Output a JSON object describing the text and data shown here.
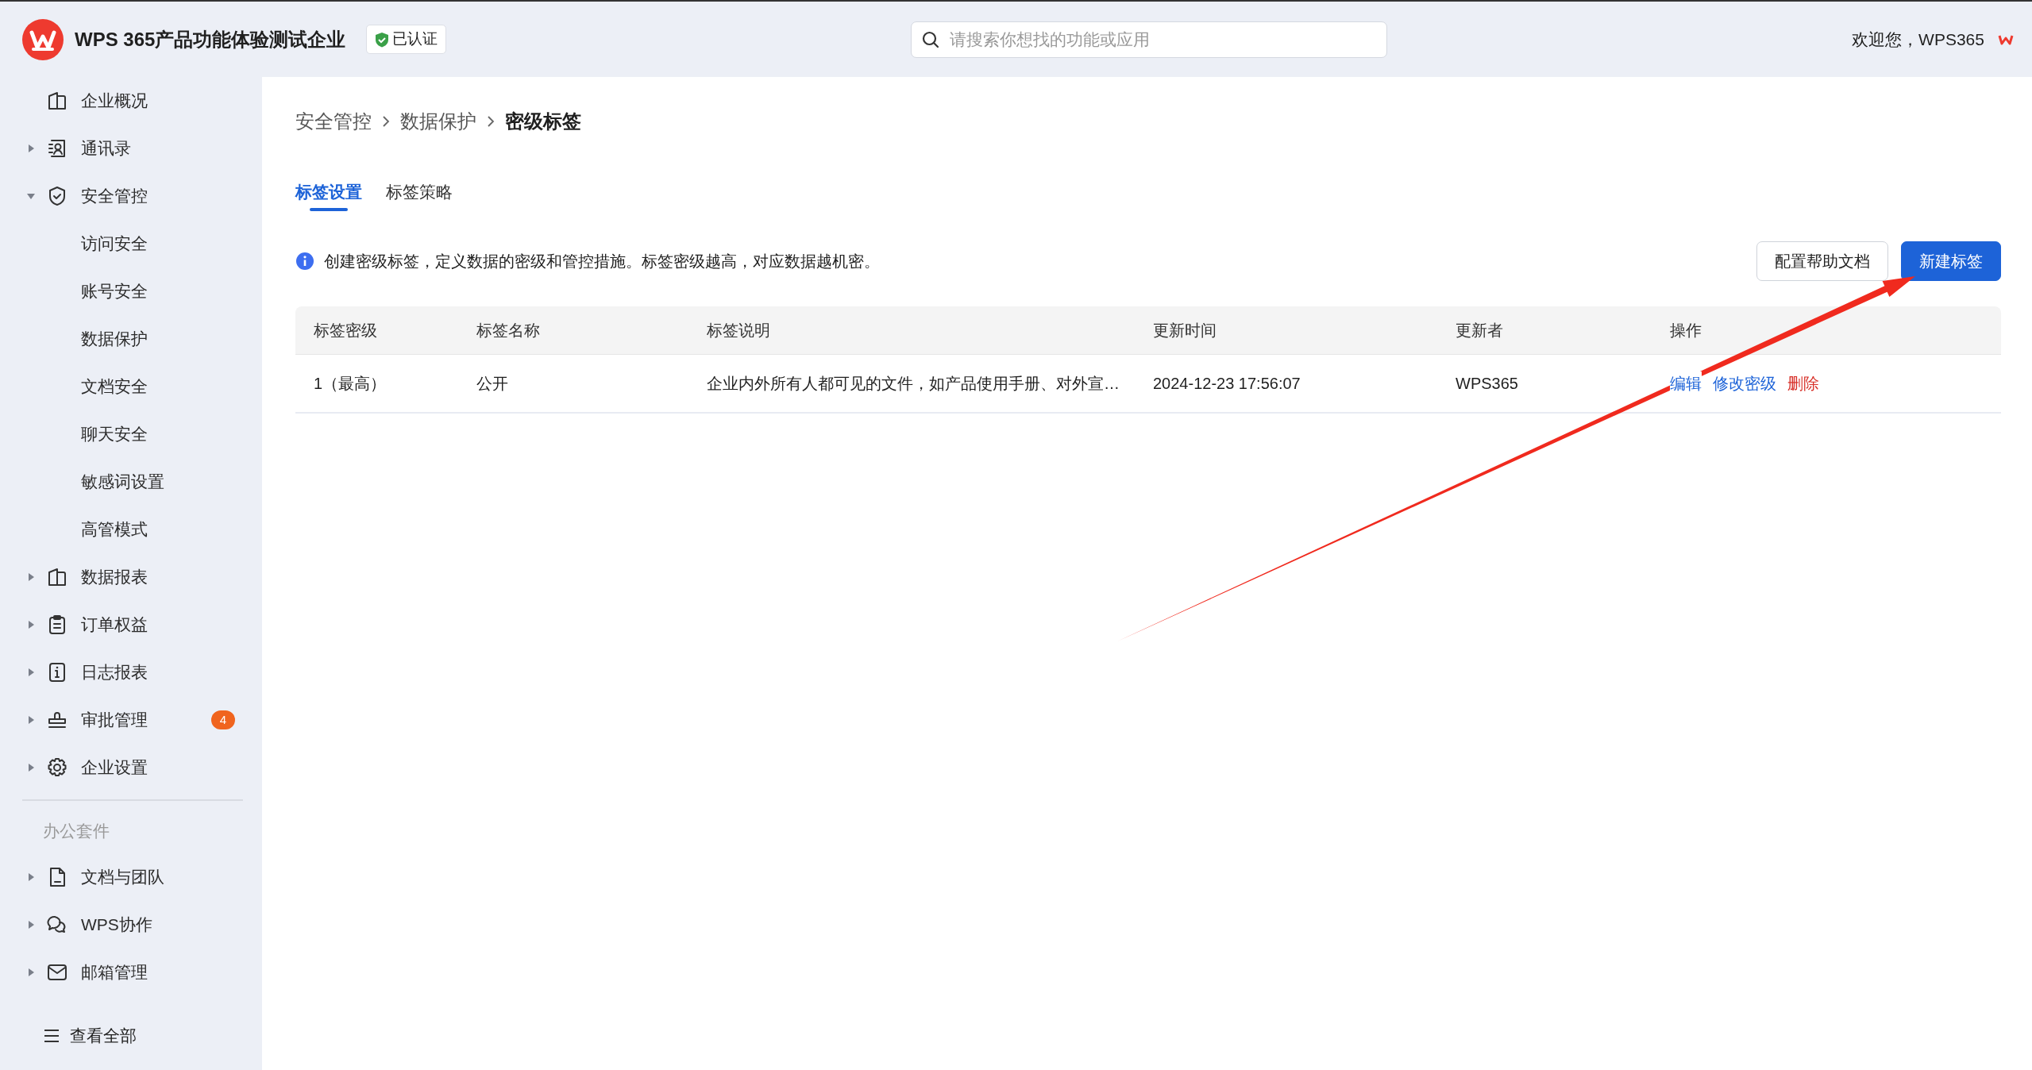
{
  "header": {
    "org_name": "WPS 365产品功能体验测试企业",
    "verified_badge": "已认证",
    "search": {
      "placeholder": "请搜索你想找的功能或应用"
    },
    "welcome": "欢迎您，WPS365"
  },
  "sidebar": {
    "sections": [
      {
        "items": [
          {
            "label": "企业概况",
            "kind": "link"
          },
          {
            "label": "通讯录",
            "kind": "parent",
            "expanded": false
          },
          {
            "label": "安全管控",
            "kind": "parent",
            "expanded": true
          },
          {
            "label": "访问安全",
            "kind": "child"
          },
          {
            "label": "账号安全",
            "kind": "child"
          },
          {
            "label": "数据保护",
            "kind": "child"
          },
          {
            "label": "文档安全",
            "kind": "child"
          },
          {
            "label": "聊天安全",
            "kind": "child"
          },
          {
            "label": "敏感词设置",
            "kind": "child"
          },
          {
            "label": "高管模式",
            "kind": "child"
          },
          {
            "label": "数据报表",
            "kind": "parent",
            "expanded": false
          },
          {
            "label": "订单权益",
            "kind": "parent",
            "expanded": false
          },
          {
            "label": "日志报表",
            "kind": "parent",
            "expanded": false
          },
          {
            "label": "审批管理",
            "kind": "parent",
            "expanded": false,
            "badge": "4"
          },
          {
            "label": "企业设置",
            "kind": "parent",
            "expanded": false
          }
        ]
      },
      {
        "heading": "办公套件",
        "items": [
          {
            "label": "文档与团队",
            "kind": "parent",
            "expanded": false
          },
          {
            "label": "WPS协作",
            "kind": "parent",
            "expanded": false
          },
          {
            "label": "邮箱管理",
            "kind": "parent",
            "expanded": false
          }
        ]
      }
    ],
    "view_all": "查看全部"
  },
  "breadcrumb": [
    "安全管控",
    "数据保护",
    "密级标签"
  ],
  "tabs": [
    {
      "label": "标签设置",
      "selected": true
    },
    {
      "label": "标签策略",
      "selected": false
    }
  ],
  "info": "创建密级标签，定义数据的密级和管控措施。标签密级越高，对应数据越机密。",
  "buttons": [
    {
      "label": "配置帮助文档",
      "kind": "secondary"
    },
    {
      "label": "新建标签",
      "kind": "primary"
    }
  ],
  "table": {
    "columns": [
      "标签密级",
      "标签名称",
      "标签说明",
      "更新时间",
      "更新者",
      "操作"
    ],
    "rows": [
      {
        "cells": [
          "1（最高）",
          "公开",
          "企业内外所有人都可见的文件，如产品使用手册、对外宣…",
          "2024-12-23 17:56:07",
          "WPS365"
        ],
        "actions": [
          {
            "label": "编辑",
            "kind": "link"
          },
          {
            "label": "修改密级",
            "kind": "link"
          },
          {
            "label": "删除",
            "kind": "danger"
          }
        ]
      }
    ]
  }
}
